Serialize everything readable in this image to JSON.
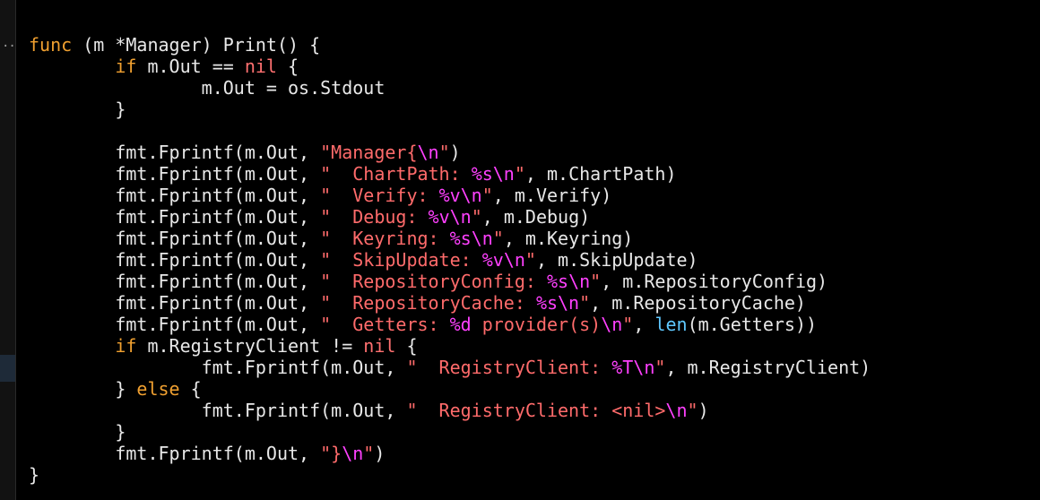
{
  "editor": {
    "gutter_fold_glyph": "..",
    "lines": [
      [
        {
          "t": "func",
          "c": "kw"
        },
        {
          "t": " (m *Manager) Print() {",
          "c": "txt"
        }
      ],
      [
        {
          "t": "\t",
          "c": "txt"
        },
        {
          "t": "if",
          "c": "kw"
        },
        {
          "t": " m.Out == ",
          "c": "txt"
        },
        {
          "t": "nil",
          "c": "nil"
        },
        {
          "t": " {",
          "c": "txt"
        }
      ],
      [
        {
          "t": "\t\tm.Out = os.Stdout",
          "c": "txt"
        }
      ],
      [
        {
          "t": "\t}",
          "c": "txt"
        }
      ],
      [
        {
          "t": "",
          "c": "txt"
        }
      ],
      [
        {
          "t": "\tfmt.Fprintf(m.Out, ",
          "c": "txt"
        },
        {
          "t": "\"Manager{",
          "c": "str"
        },
        {
          "t": "\\n",
          "c": "esc"
        },
        {
          "t": "\"",
          "c": "str"
        },
        {
          "t": ")",
          "c": "txt"
        }
      ],
      [
        {
          "t": "\tfmt.Fprintf(m.Out, ",
          "c": "txt"
        },
        {
          "t": "\"  ChartPath: ",
          "c": "str"
        },
        {
          "t": "%s\\n",
          "c": "esc"
        },
        {
          "t": "\"",
          "c": "str"
        },
        {
          "t": ", m.ChartPath)",
          "c": "txt"
        }
      ],
      [
        {
          "t": "\tfmt.Fprintf(m.Out, ",
          "c": "txt"
        },
        {
          "t": "\"  Verify: ",
          "c": "str"
        },
        {
          "t": "%v\\n",
          "c": "esc"
        },
        {
          "t": "\"",
          "c": "str"
        },
        {
          "t": ", m.Verify)",
          "c": "txt"
        }
      ],
      [
        {
          "t": "\tfmt.Fprintf(m.Out, ",
          "c": "txt"
        },
        {
          "t": "\"  Debug: ",
          "c": "str"
        },
        {
          "t": "%v\\n",
          "c": "esc"
        },
        {
          "t": "\"",
          "c": "str"
        },
        {
          "t": ", m.Debug)",
          "c": "txt"
        }
      ],
      [
        {
          "t": "\tfmt.Fprintf(m.Out, ",
          "c": "txt"
        },
        {
          "t": "\"  Keyring: ",
          "c": "str"
        },
        {
          "t": "%s\\n",
          "c": "esc"
        },
        {
          "t": "\"",
          "c": "str"
        },
        {
          "t": ", m.Keyring)",
          "c": "txt"
        }
      ],
      [
        {
          "t": "\tfmt.Fprintf(m.Out, ",
          "c": "txt"
        },
        {
          "t": "\"  SkipUpdate: ",
          "c": "str"
        },
        {
          "t": "%v\\n",
          "c": "esc"
        },
        {
          "t": "\"",
          "c": "str"
        },
        {
          "t": ", m.SkipUpdate)",
          "c": "txt"
        }
      ],
      [
        {
          "t": "\tfmt.Fprintf(m.Out, ",
          "c": "txt"
        },
        {
          "t": "\"  RepositoryConfig: ",
          "c": "str"
        },
        {
          "t": "%s\\n",
          "c": "esc"
        },
        {
          "t": "\"",
          "c": "str"
        },
        {
          "t": ", m.RepositoryConfig)",
          "c": "txt"
        }
      ],
      [
        {
          "t": "\tfmt.Fprintf(m.Out, ",
          "c": "txt"
        },
        {
          "t": "\"  RepositoryCache: ",
          "c": "str"
        },
        {
          "t": "%s\\n",
          "c": "esc"
        },
        {
          "t": "\"",
          "c": "str"
        },
        {
          "t": ", m.RepositoryCache)",
          "c": "txt"
        }
      ],
      [
        {
          "t": "\tfmt.Fprintf(m.Out, ",
          "c": "txt"
        },
        {
          "t": "\"  Getters: ",
          "c": "str"
        },
        {
          "t": "%d",
          "c": "esc"
        },
        {
          "t": " provider(s)",
          "c": "str"
        },
        {
          "t": "\\n",
          "c": "esc"
        },
        {
          "t": "\"",
          "c": "str"
        },
        {
          "t": ", ",
          "c": "txt"
        },
        {
          "t": "len",
          "c": "fn"
        },
        {
          "t": "(m.Getters))",
          "c": "txt"
        }
      ],
      [
        {
          "t": "\t",
          "c": "txt"
        },
        {
          "t": "if",
          "c": "kw"
        },
        {
          "t": " m.RegistryClient != ",
          "c": "txt"
        },
        {
          "t": "nil",
          "c": "nil"
        },
        {
          "t": " {",
          "c": "txt"
        }
      ],
      [
        {
          "t": "\t\tfmt.Fprintf(m.Out, ",
          "c": "txt"
        },
        {
          "t": "\"  RegistryClient: ",
          "c": "str"
        },
        {
          "t": "%T\\n",
          "c": "esc"
        },
        {
          "t": "\"",
          "c": "str"
        },
        {
          "t": ", m.RegistryClient)",
          "c": "txt"
        }
      ],
      [
        {
          "t": "\t} ",
          "c": "txt"
        },
        {
          "t": "else",
          "c": "kw"
        },
        {
          "t": " {",
          "c": "txt"
        }
      ],
      [
        {
          "t": "\t\tfmt.Fprintf(m.Out, ",
          "c": "txt"
        },
        {
          "t": "\"  RegistryClient: <nil>",
          "c": "str"
        },
        {
          "t": "\\n",
          "c": "esc"
        },
        {
          "t": "\"",
          "c": "str"
        },
        {
          "t": ")",
          "c": "txt"
        }
      ],
      [
        {
          "t": "\t}",
          "c": "txt"
        }
      ],
      [
        {
          "t": "\tfmt.Fprintf(m.Out, ",
          "c": "txt"
        },
        {
          "t": "\"}",
          "c": "str"
        },
        {
          "t": "\\n",
          "c": "esc"
        },
        {
          "t": "\"",
          "c": "str"
        },
        {
          "t": ")",
          "c": "txt"
        }
      ],
      [
        {
          "t": "}",
          "c": "txt"
        }
      ]
    ]
  }
}
